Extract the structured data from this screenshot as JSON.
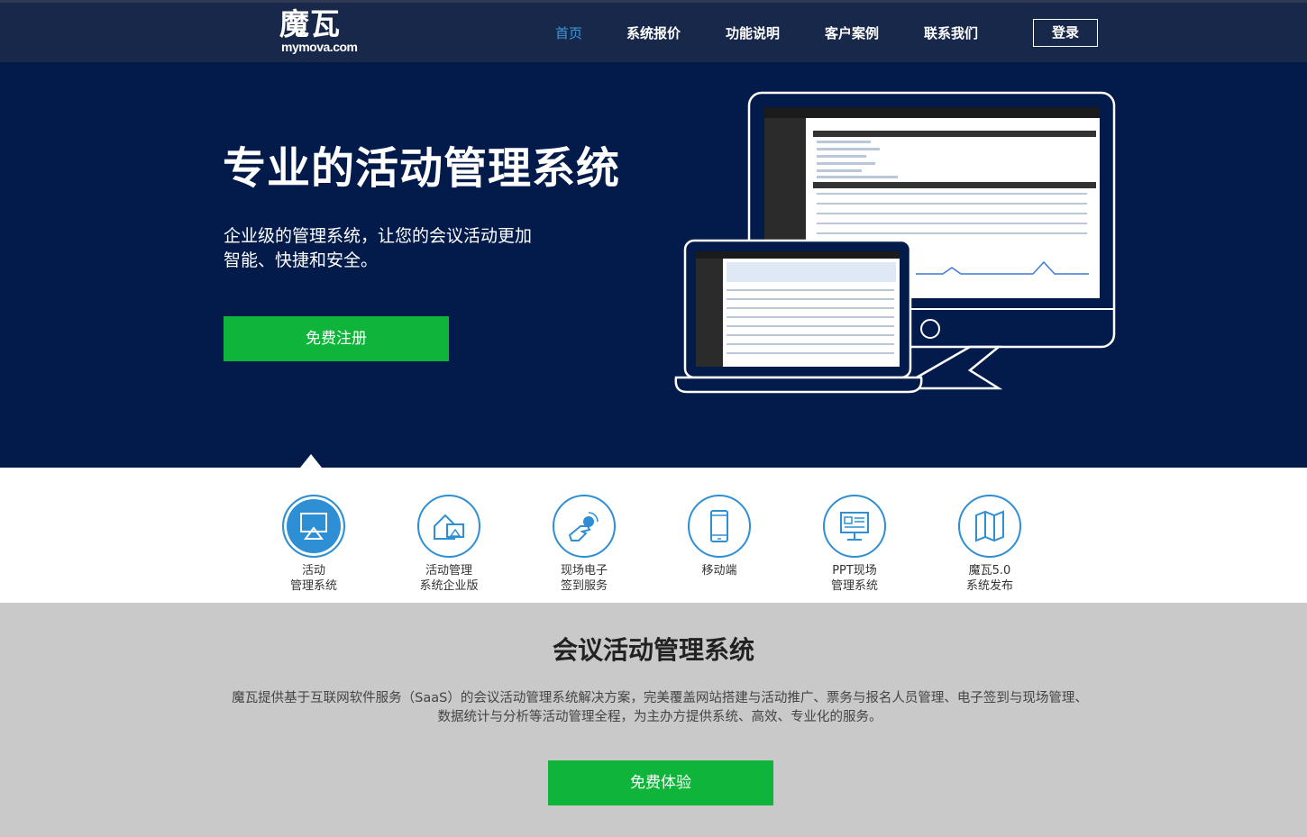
{
  "header": {
    "logo_cn": "魔瓦",
    "logo_en": "mymova.com",
    "nav": [
      "首页",
      "系统报价",
      "功能说明",
      "客户案例",
      "联系我们"
    ],
    "login": "登录"
  },
  "hero": {
    "title": "专业的活动管理系统",
    "subtitle_line1": "企业级的管理系统，让您的会议活动更加",
    "subtitle_line2": "智能、快捷和安全。",
    "cta": "免费注册"
  },
  "features": [
    {
      "line1": "活动",
      "line2": "管理系统",
      "icon": "presentation-icon"
    },
    {
      "line1": "活动管理",
      "line2": "系统企业版",
      "icon": "building-icon"
    },
    {
      "line1": "现场电子",
      "line2": "签到服务",
      "icon": "hand-tap-icon"
    },
    {
      "line1": "移动端",
      "line2": "",
      "icon": "mobile-icon"
    },
    {
      "line1": "PPT现场",
      "line2": "管理系统",
      "icon": "ppt-board-icon"
    },
    {
      "line1": "魔瓦5.0",
      "line2": "系统发布",
      "icon": "map-icon"
    }
  ],
  "intro": {
    "title": "会议活动管理系统",
    "desc": "魔瓦提供基于互联网软件服务（SaaS）的会议活动管理系统解决方案，完美覆盖网站搭建与活动推广、票务与报名人员管理、电子签到与现场管理、数据统计与分析等活动管理全程，为主办方提供系统、高效、专业化的服务。",
    "cta": "免费体验"
  },
  "colors": {
    "header_bg": "#18284a",
    "hero_bg": "#031b4a",
    "accent_blue": "#2e8fd4",
    "nav_active": "#3a9ad9",
    "green": "#0fb53a",
    "intro_bg": "#c9c9c9"
  }
}
